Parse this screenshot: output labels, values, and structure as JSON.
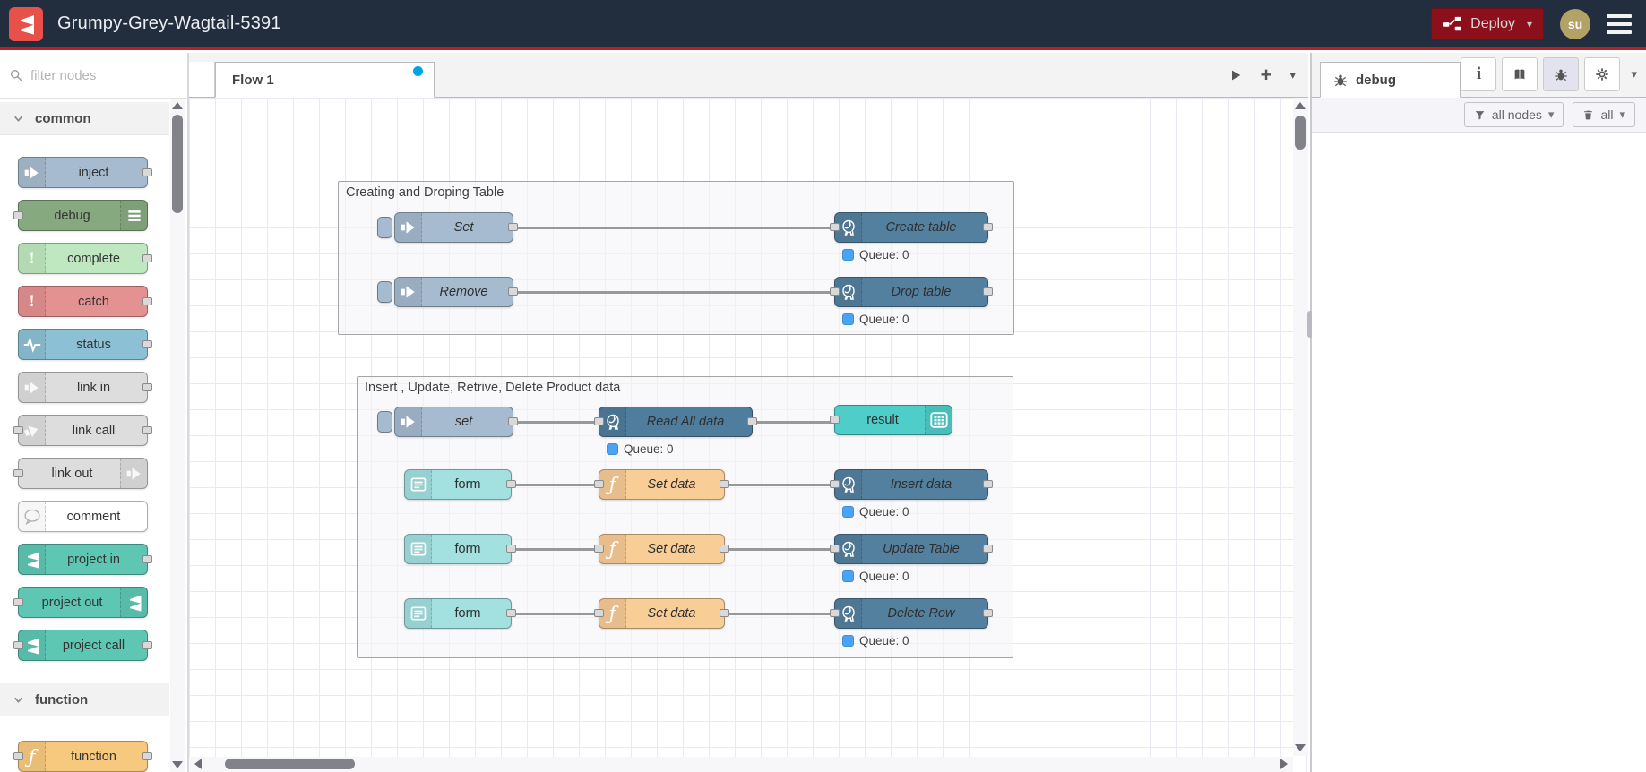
{
  "header": {
    "title": "Grumpy-Grey-Wagtail-5391",
    "deploy_label": "Deploy",
    "avatar_initials": "su",
    "colors": {
      "header_bg": "#222e3e",
      "accent_red": "#b91f26",
      "deploy_bg": "#8c101c",
      "logo_red": "#e8504a",
      "avatar_bg": "#b2a266"
    }
  },
  "palette": {
    "filter_placeholder": "filter nodes",
    "categories": [
      {
        "label": "common",
        "items": [
          {
            "label": "inject",
            "color": "#a6bbcf",
            "icon": "arrow-in-icon"
          },
          {
            "label": "debug",
            "color": "#87a980",
            "icon": "list-icon"
          },
          {
            "label": "complete",
            "color": "#c0e8c0",
            "icon": "exclamation-icon"
          },
          {
            "label": "catch",
            "color": "#e49191",
            "icon": "exclamation-icon"
          },
          {
            "label": "status",
            "color": "#8cc0d4",
            "icon": "pulse-icon"
          },
          {
            "label": "link in",
            "color": "#dddddd",
            "icon": "link-icon"
          },
          {
            "label": "link call",
            "color": "#dddddd",
            "icon": "link-icon"
          },
          {
            "label": "link out",
            "color": "#dddddd",
            "icon": "link-icon"
          },
          {
            "label": "comment",
            "color": "#ffffff",
            "icon": "comment-bubble-icon"
          },
          {
            "label": "project in",
            "color": "#5ec7b4",
            "icon": "node-red-logo-icon"
          },
          {
            "label": "project out",
            "color": "#5ec7b4",
            "icon": "node-red-logo-icon"
          },
          {
            "label": "project call",
            "color": "#5ec7b4",
            "icon": "node-red-logo-icon"
          }
        ]
      },
      {
        "label": "function",
        "items": [
          {
            "label": "function",
            "color": "#f7c97f",
            "icon": "function-icon"
          }
        ]
      }
    ]
  },
  "workspace": {
    "tab_label": "Flow 1",
    "groups": [
      {
        "label": "Creating and Droping Table",
        "nodes": [
          {
            "label": "Set",
            "type": "inject",
            "color": "#a6bbcf"
          },
          {
            "label": "Create table",
            "type": "postgresql",
            "color": "#54809f",
            "status": "Queue: 0"
          },
          {
            "label": "Remove",
            "type": "inject",
            "color": "#a6bbcf"
          },
          {
            "label": "Drop table",
            "type": "postgresql",
            "color": "#54809f",
            "status": "Queue: 0"
          }
        ]
      },
      {
        "label": "Insert , Update, Retrive, Delete Product data",
        "nodes": [
          {
            "label": "set",
            "type": "inject",
            "color": "#a6bbcf"
          },
          {
            "label": "Read All data",
            "type": "postgresql",
            "color": "#4f7d9d",
            "status": "Queue: 0"
          },
          {
            "label": "result",
            "type": "table",
            "color": "#4ecdc9"
          },
          {
            "label": "form",
            "type": "form",
            "color": "#a3e0e0"
          },
          {
            "label": "Set data",
            "type": "function",
            "color": "#f9cd96"
          },
          {
            "label": "Insert data",
            "type": "postgresql",
            "color": "#54809f",
            "status": "Queue: 0"
          },
          {
            "label": "form",
            "type": "form",
            "color": "#a3e0e0"
          },
          {
            "label": "Set data",
            "type": "function",
            "color": "#f9cd96"
          },
          {
            "label": "Update Table",
            "type": "postgresql",
            "color": "#54809f",
            "status": "Queue: 0"
          },
          {
            "label": "form",
            "type": "form",
            "color": "#a3e0e0"
          },
          {
            "label": "Set data",
            "type": "function",
            "color": "#f9cd96"
          },
          {
            "label": "Delete Row",
            "type": "postgresql",
            "color": "#54809f",
            "status": "Queue: 0"
          }
        ]
      }
    ]
  },
  "sidebar": {
    "tab_label": "debug",
    "filter_button": "all nodes",
    "clear_button": "all"
  }
}
